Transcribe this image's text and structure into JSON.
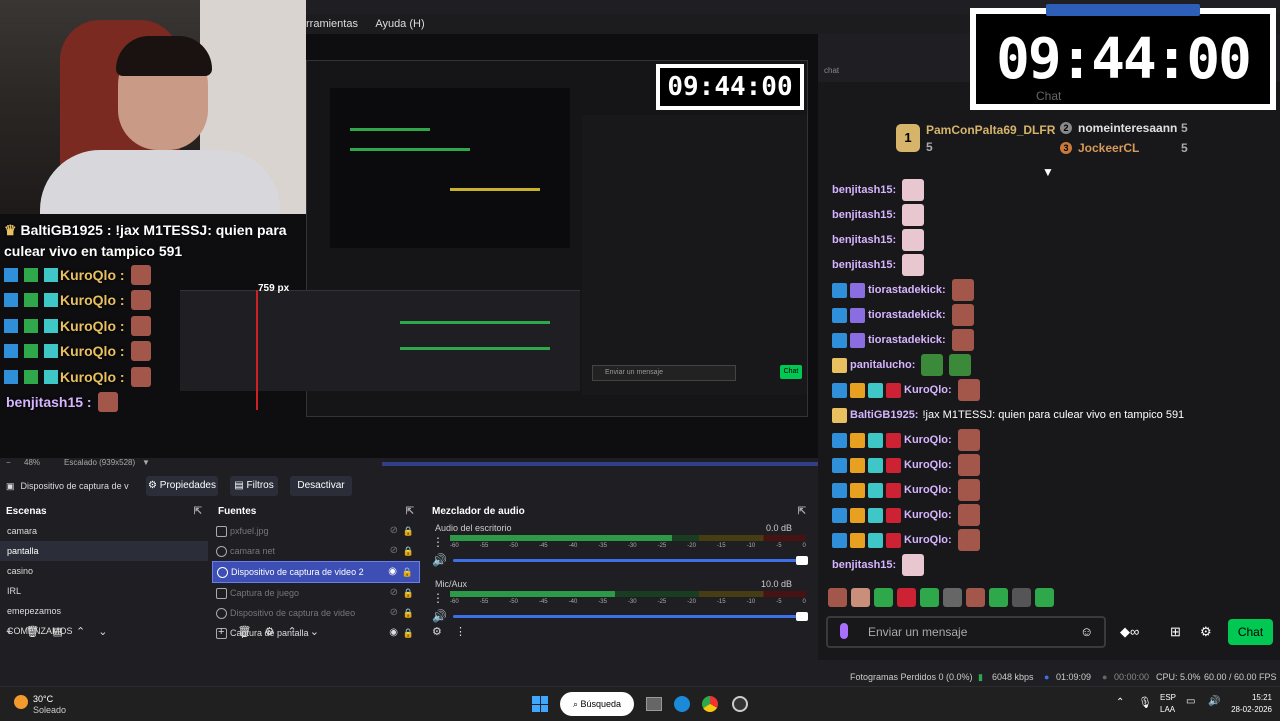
{
  "menubar": {
    "items": [
      "rramientas",
      "Ayuda (H)"
    ]
  },
  "preview": {
    "nested_px_label": "759 px",
    "nested_clock": "09:44:00",
    "nested_chat_btn": "Chat",
    "nested_chat_placeholder": "Enviar un mensaje"
  },
  "overlay_chat": {
    "highlight": {
      "user": "BaltiGB1925 :",
      "text": "!jax M1TESSJ: quien para culear vivo en tampico 591"
    },
    "rows": [
      {
        "user": "KuroQlo :"
      },
      {
        "user": "KuroQlo :"
      },
      {
        "user": "KuroQlo :"
      },
      {
        "user": "KuroQlo :"
      },
      {
        "user": "KuroQlo :"
      },
      {
        "user": "benjitash15 :"
      }
    ]
  },
  "zoombar": {
    "zoom": "48%",
    "scale": "Escalado (939x528)"
  },
  "source_toolbar": {
    "source_name": "Dispositivo de captura de v",
    "props": "Propiedades",
    "filters": "Filtros",
    "deactivate": "Desactivar"
  },
  "scenes": {
    "title": "Escenas",
    "items": [
      "camara",
      "pantalla",
      "casino",
      "IRL",
      "emepezamos",
      "COMENZAMOS"
    ]
  },
  "sources": {
    "title": "Fuentes",
    "items": [
      "pxfuel.jpg",
      "camara net",
      "Dispositivo de captura de video 2",
      "Captura de juego",
      "Dispositivo de captura de video",
      "Captura de pantalla"
    ]
  },
  "mixer": {
    "title": "Mezclador de audio",
    "channels": [
      {
        "name": "Audio del escritorio",
        "db": "0.0 dB",
        "level": 0.78
      },
      {
        "name": "Mic/Aux",
        "db": "10.0 dB",
        "level": 0.58
      }
    ],
    "scale": [
      "-60",
      "-55",
      "-50",
      "-45",
      "-40",
      "-35",
      "-30",
      "-25",
      "-20",
      "-15",
      "-10",
      "-5",
      "0"
    ]
  },
  "chat": {
    "header": "chat",
    "leaderboard": [
      {
        "name": "PamConPalta69_DLFR",
        "score": "5",
        "color": "#d6b46a"
      },
      {
        "name": "nomeinteresaann",
        "score": "5",
        "color": "#e0e0e0"
      },
      {
        "name": "JockeerCL",
        "score": "5",
        "color": "#d69a5a"
      }
    ],
    "messages": [
      {
        "user": "benjitash15:",
        "text": "",
        "emotes": 1
      },
      {
        "user": "benjitash15:",
        "text": "",
        "emotes": 1
      },
      {
        "user": "benjitash15:",
        "text": "",
        "emotes": 1
      },
      {
        "user": "benjitash15:",
        "text": "",
        "emotes": 1
      },
      {
        "user": "tiorastadekick:",
        "text": "",
        "emotes": 1
      },
      {
        "user": "tiorastadekick:",
        "text": "",
        "emotes": 1
      },
      {
        "user": "tiorastadekick:",
        "text": "",
        "emotes": 1
      },
      {
        "user": "panitalucho:",
        "text": "",
        "emotes": 2
      },
      {
        "user": "KuroQlo:",
        "text": "",
        "emotes": 1
      },
      {
        "user": "BaltiGB1925:",
        "text": "!jax M1TESSJ: quien para culear vivo en tampico 591",
        "emotes": 0
      },
      {
        "user": "KuroQlo:",
        "text": "",
        "emotes": 1
      },
      {
        "user": "KuroQlo:",
        "text": "",
        "emotes": 1
      },
      {
        "user": "KuroQlo:",
        "text": "",
        "emotes": 1
      },
      {
        "user": "KuroQlo:",
        "text": "",
        "emotes": 1
      },
      {
        "user": "KuroQlo:",
        "text": "",
        "emotes": 1
      },
      {
        "user": "benjitash15:",
        "text": "",
        "emotes": 1
      }
    ],
    "input_placeholder": "Enviar un mensaje",
    "send_label": "Chat"
  },
  "clock": {
    "time": "09:44:00",
    "label": "Chat"
  },
  "status": {
    "dropped": "Fotogramas Perdidos 0 (0.0%)",
    "kbps": "6048 kbps",
    "rec_time": "01:09:09",
    "stream_time": "00:00:00",
    "cpu": "CPU: 5.0%",
    "fps": "60.00 / 60.00 FPS"
  },
  "taskbar": {
    "weather_temp": "30°C",
    "weather_desc": "Soleado",
    "search": "Búsqueda",
    "lang1": "ESP",
    "lang2": "LAA",
    "time": "15:21",
    "date": "28-02-2026"
  }
}
